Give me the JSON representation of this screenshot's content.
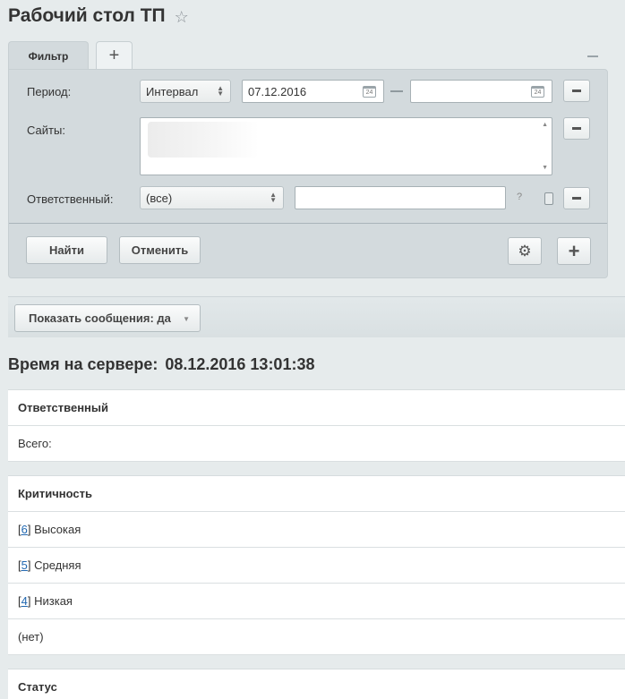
{
  "page": {
    "title": "Рабочий стол ТП"
  },
  "filter": {
    "tab_label": "Фильтр",
    "add_tab_label": "+",
    "period_label": "Период:",
    "period_type": "Интервал",
    "date_from": "07.12.2016",
    "date_to": "",
    "calendar_day": "24",
    "sites_label": "Сайты:",
    "responsible_label": "Ответственный:",
    "responsible_value": "(все)",
    "responsible_text": "",
    "help_mark": "?",
    "find_button": "Найти",
    "cancel_button": "Отменить"
  },
  "toolbar": {
    "show_messages": "Показать сообщения: да"
  },
  "server": {
    "label": "Время на сервере:",
    "time": "08.12.2016 13:01:38"
  },
  "responsible_table": {
    "header": "Ответственный",
    "rows": [
      "Всего:"
    ]
  },
  "criticality_table": {
    "header": "Критичность",
    "rows": [
      {
        "count": "6",
        "label": "Высокая"
      },
      {
        "count": "5",
        "label": "Средняя"
      },
      {
        "count": "4",
        "label": "Низкая"
      },
      {
        "count": "",
        "label": "(нет)"
      }
    ]
  },
  "status_table": {
    "header": "Статус"
  },
  "icons": {
    "favorite": "star-icon",
    "settings": "gear-icon",
    "add": "plus-icon",
    "remove": "minus-icon",
    "calendar": "calendar-icon"
  }
}
